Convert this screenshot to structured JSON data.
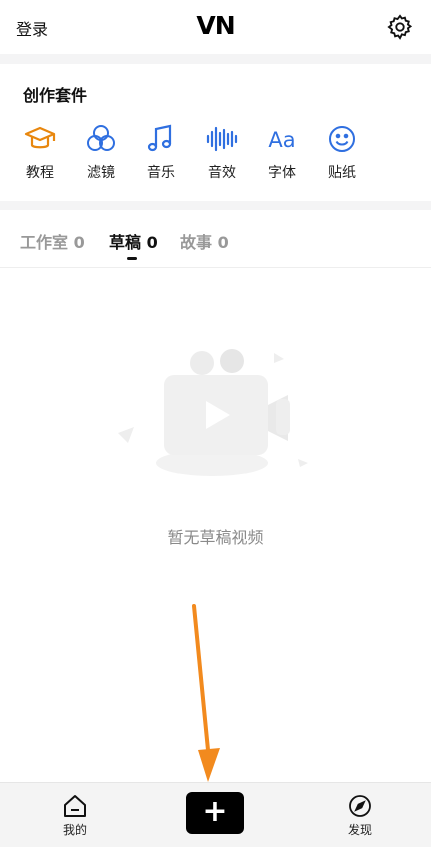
{
  "header": {
    "login_label": "登录",
    "logo_text": "VN"
  },
  "suite": {
    "title": "创作套件",
    "items": [
      {
        "label": "教程",
        "icon": "graduation-cap-icon",
        "color": "#E8870E"
      },
      {
        "label": "滤镜",
        "icon": "filter-circles-icon",
        "color": "#2F6FE0"
      },
      {
        "label": "音乐",
        "icon": "music-note-icon",
        "color": "#2F6FE0"
      },
      {
        "label": "音效",
        "icon": "sound-wave-icon",
        "color": "#2F6FE0"
      },
      {
        "label": "字体",
        "icon": "font-aa-icon",
        "color": "#2F6FE0"
      },
      {
        "label": "贴纸",
        "icon": "smiley-sticker-icon",
        "color": "#2F6FE0"
      }
    ]
  },
  "tabs": [
    {
      "label": "工作室 0",
      "active": false
    },
    {
      "label": "草稿 0",
      "active": true
    },
    {
      "label": "故事 0",
      "active": false
    }
  ],
  "empty_state": {
    "message": "暂无草稿视频"
  },
  "bottom_nav": {
    "mine_label": "我的",
    "create_label": "+",
    "discover_label": "发现"
  },
  "colors": {
    "accent_orange": "#F28A1E",
    "icon_blue": "#2F6FE0"
  }
}
